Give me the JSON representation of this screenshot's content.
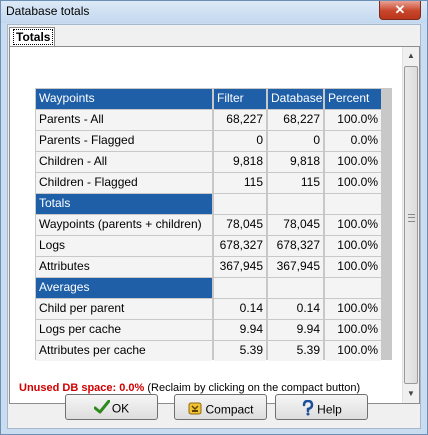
{
  "window": {
    "title": "Database totals",
    "close_label": "✕"
  },
  "tab": {
    "label": "Totals"
  },
  "table": {
    "columns": [
      "Waypoints",
      "Filter",
      "Database",
      "Percent"
    ],
    "waypoint_rows": [
      {
        "label": "Parents - All",
        "filter": "68,227",
        "database": "68,227",
        "percent": "100.0%"
      },
      {
        "label": "Parents - Flagged",
        "filter": "0",
        "database": "0",
        "percent": "0.0%"
      },
      {
        "label": "Children - All",
        "filter": "9,818",
        "database": "9,818",
        "percent": "100.0%"
      },
      {
        "label": "Children - Flagged",
        "filter": "115",
        "database": "115",
        "percent": "100.0%"
      }
    ],
    "totals_header": "Totals",
    "totals_rows": [
      {
        "label": "Waypoints (parents + children)",
        "filter": "78,045",
        "database": "78,045",
        "percent": "100.0%"
      },
      {
        "label": "Logs",
        "filter": "678,327",
        "database": "678,327",
        "percent": "100.0%"
      },
      {
        "label": "Attributes",
        "filter": "367,945",
        "database": "367,945",
        "percent": "100.0%"
      }
    ],
    "averages_header": "Averages",
    "averages_rows": [
      {
        "label": "Child per parent",
        "filter": "0.14",
        "database": "0.14",
        "percent": "100.0%"
      },
      {
        "label": "Logs per cache",
        "filter": "9.94",
        "database": "9.94",
        "percent": "100.0%"
      },
      {
        "label": "Attributes per cache",
        "filter": "5.39",
        "database": "5.39",
        "percent": "100.0%"
      }
    ]
  },
  "note": {
    "label": "Unused DB space: 0.0%",
    "hint": "(Reclaim by clicking on the compact button)"
  },
  "buttons": {
    "ok": "OK",
    "compact": "Compact",
    "help": "Help"
  },
  "icons": {
    "ok": "checkmark-icon",
    "compact": "compact-icon",
    "help": "help-icon",
    "close": "close-icon"
  },
  "colors": {
    "header_bg": "#1f5fa8",
    "note_red": "#d00000"
  }
}
